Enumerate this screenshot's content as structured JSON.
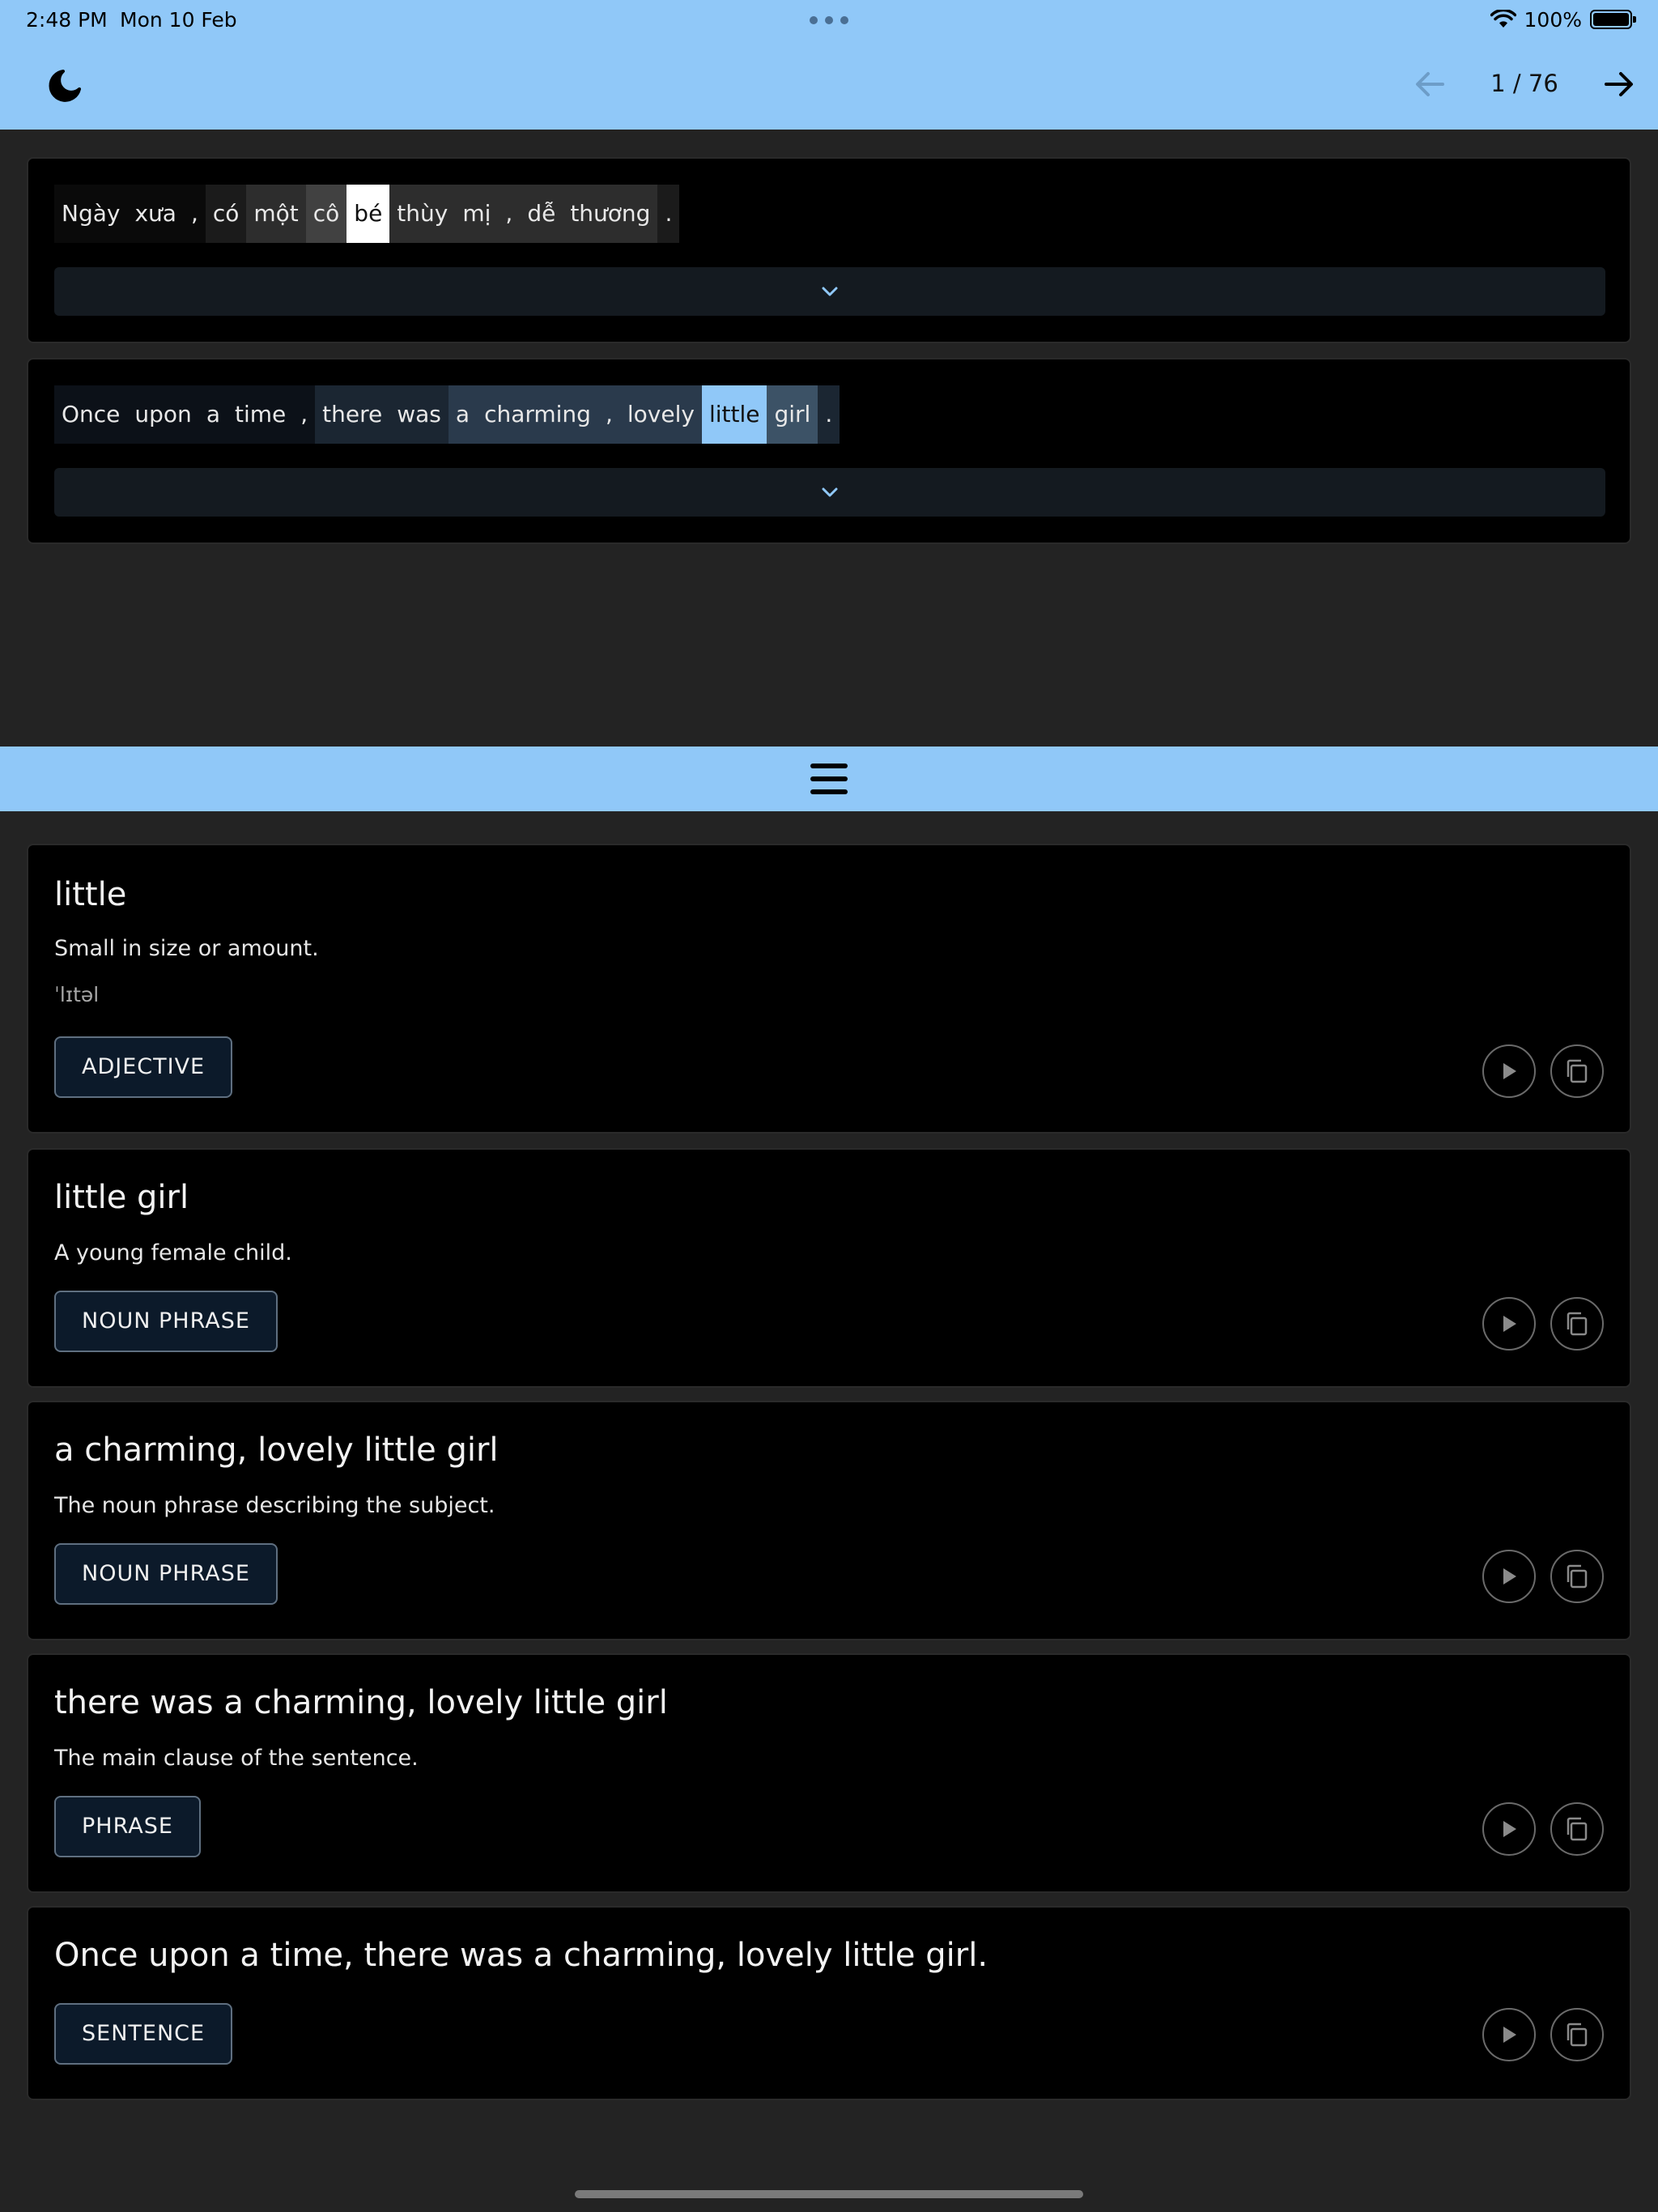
{
  "status_bar": {
    "time": "2:48 PM",
    "date": "Mon 10 Feb",
    "battery": "100%"
  },
  "toolbar": {
    "theme_icon": "moon-icon",
    "prev_icon": "arrow-left-icon",
    "next_icon": "arrow-right-icon",
    "page_counter": "1 / 76"
  },
  "colors": {
    "accent": "#90c8f8",
    "background": "#232323",
    "card": "#000000",
    "selected_token": "#ffffff",
    "highlight_token": "#90c8f8"
  },
  "source_sentence": {
    "tokens": [
      {
        "text": "Ngày",
        "bg": "#0a0a0a",
        "fg": "#e8e8e8"
      },
      {
        "text": "xưa",
        "bg": "#0a0a0a",
        "fg": "#e8e8e8"
      },
      {
        "text": ",",
        "bg": "#0a0a0a",
        "fg": "#e8e8e8"
      },
      {
        "text": "có",
        "bg": "#1b1b1b",
        "fg": "#e8e8e8"
      },
      {
        "text": "một",
        "bg": "#2d2d2d",
        "fg": "#e8e8e8"
      },
      {
        "text": "cô",
        "bg": "#414141",
        "fg": "#e8e8e8"
      },
      {
        "text": "bé",
        "bg": "#ffffff",
        "fg": "#111111"
      },
      {
        "text": "thùy",
        "bg": "#2d2d2d",
        "fg": "#e8e8e8"
      },
      {
        "text": "mị",
        "bg": "#2d2d2d",
        "fg": "#e8e8e8"
      },
      {
        "text": ",",
        "bg": "#2d2d2d",
        "fg": "#e8e8e8"
      },
      {
        "text": "dễ",
        "bg": "#2d2d2d",
        "fg": "#e8e8e8"
      },
      {
        "text": "thương",
        "bg": "#2d2d2d",
        "fg": "#e8e8e8"
      },
      {
        "text": ".",
        "bg": "#1b1b1b",
        "fg": "#e8e8e8"
      }
    ]
  },
  "target_sentence": {
    "tokens": [
      {
        "text": "Once",
        "bg": "#0c1118",
        "fg": "#e8e8e8"
      },
      {
        "text": "upon",
        "bg": "#0c1118",
        "fg": "#e8e8e8"
      },
      {
        "text": "a",
        "bg": "#0c1118",
        "fg": "#e8e8e8"
      },
      {
        "text": "time",
        "bg": "#0c1118",
        "fg": "#e8e8e8"
      },
      {
        "text": ",",
        "bg": "#0c1118",
        "fg": "#e8e8e8"
      },
      {
        "text": "there",
        "bg": "#1b2632",
        "fg": "#e8e8e8"
      },
      {
        "text": "was",
        "bg": "#1b2632",
        "fg": "#e8e8e8"
      },
      {
        "text": "a",
        "bg": "#2a3a4c",
        "fg": "#e8e8e8"
      },
      {
        "text": "charming",
        "bg": "#2a3a4c",
        "fg": "#e8e8e8"
      },
      {
        "text": ",",
        "bg": "#2a3a4c",
        "fg": "#e8e8e8"
      },
      {
        "text": "lovely",
        "bg": "#2a3a4c",
        "fg": "#e8e8e8"
      },
      {
        "text": "little",
        "bg": "#90c8f8",
        "fg": "#111111"
      },
      {
        "text": "girl",
        "bg": "#3c5266",
        "fg": "#e8e8e8"
      },
      {
        "text": ".",
        "bg": "#1b2632",
        "fg": "#e8e8e8"
      }
    ]
  },
  "definitions": [
    {
      "term": "little",
      "description": "Small in size or amount.",
      "phonetic": "ˈlɪtəl",
      "pos": "ADJECTIVE"
    },
    {
      "term": "little girl",
      "description": "A young female child.",
      "pos": "NOUN PHRASE"
    },
    {
      "term": "a charming, lovely little girl",
      "description": "The noun phrase describing the subject.",
      "pos": "NOUN PHRASE"
    },
    {
      "term": "there was a charming, lovely little girl",
      "description": "The main clause of the sentence.",
      "pos": "PHRASE"
    },
    {
      "term": "Once upon a time, there was a charming, lovely little girl.",
      "pos": "SENTENCE"
    }
  ],
  "card_icons": {
    "play": "play-icon",
    "copy": "copy-icon",
    "expand": "chevron-down-icon",
    "splitter": "menu-icon"
  }
}
